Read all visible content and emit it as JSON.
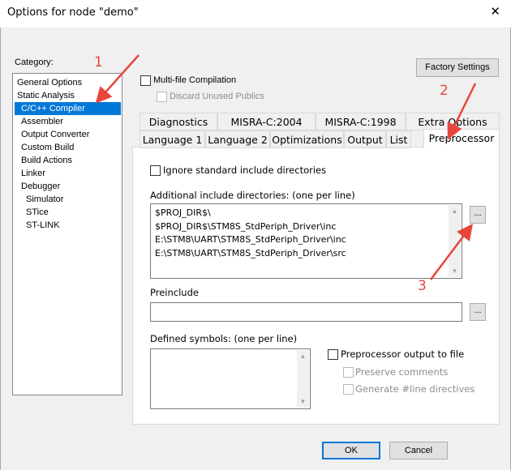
{
  "window": {
    "title": "Options for node \"demo\"",
    "close_glyph": "✕"
  },
  "category": {
    "label": "Category:",
    "items": [
      "General Options",
      "Static Analysis",
      "C/C++ Compiler",
      "Assembler",
      "Output Converter",
      "Custom Build",
      "Build Actions",
      "Linker",
      "Debugger",
      "Simulator",
      "STice",
      "ST-LINK"
    ],
    "selected": "C/C++ Compiler"
  },
  "top_options": {
    "factory_settings_label": "Factory Settings",
    "multifile_label": "Multi-file Compilation",
    "multifile_checked": false,
    "discard_label": "Discard Unused Publics",
    "discard_checked": false
  },
  "tabs": {
    "row1": [
      "Diagnostics",
      "MISRA-C:2004",
      "MISRA-C:1998",
      "Extra Options"
    ],
    "row2": [
      "Language 1",
      "Language 2",
      "Optimizations",
      "Output",
      "List",
      "Preprocessor"
    ],
    "active": "Preprocessor"
  },
  "preprocessor": {
    "ignore_std_label": "Ignore standard include directories",
    "ignore_std_checked": false,
    "additional_label": "Additional include directories: (one per line)",
    "include_dirs": [
      "$PROJ_DIR$\\",
      "$PROJ_DIR$\\STM8S_StdPeriph_Driver\\inc",
      "E:\\STM8\\UART\\STM8S_StdPeriph_Driver\\inc",
      "E:\\STM8\\UART\\STM8S_StdPeriph_Driver\\src"
    ],
    "browse_label": "...",
    "preinclude_label": "Preinclude",
    "preinclude_value": "",
    "defined_label": "Defined symbols: (one per line)",
    "defined_value": "",
    "pp_output_label": "Preprocessor output to file",
    "pp_output_checked": false,
    "preserve_comments_label": "Preserve comments",
    "generate_line_label": "Generate #line directives"
  },
  "footer": {
    "ok_label": "OK",
    "cancel_label": "Cancel"
  },
  "annotations": {
    "n1": "1",
    "n2": "2",
    "n3": "3",
    "color": "#e8453c"
  }
}
